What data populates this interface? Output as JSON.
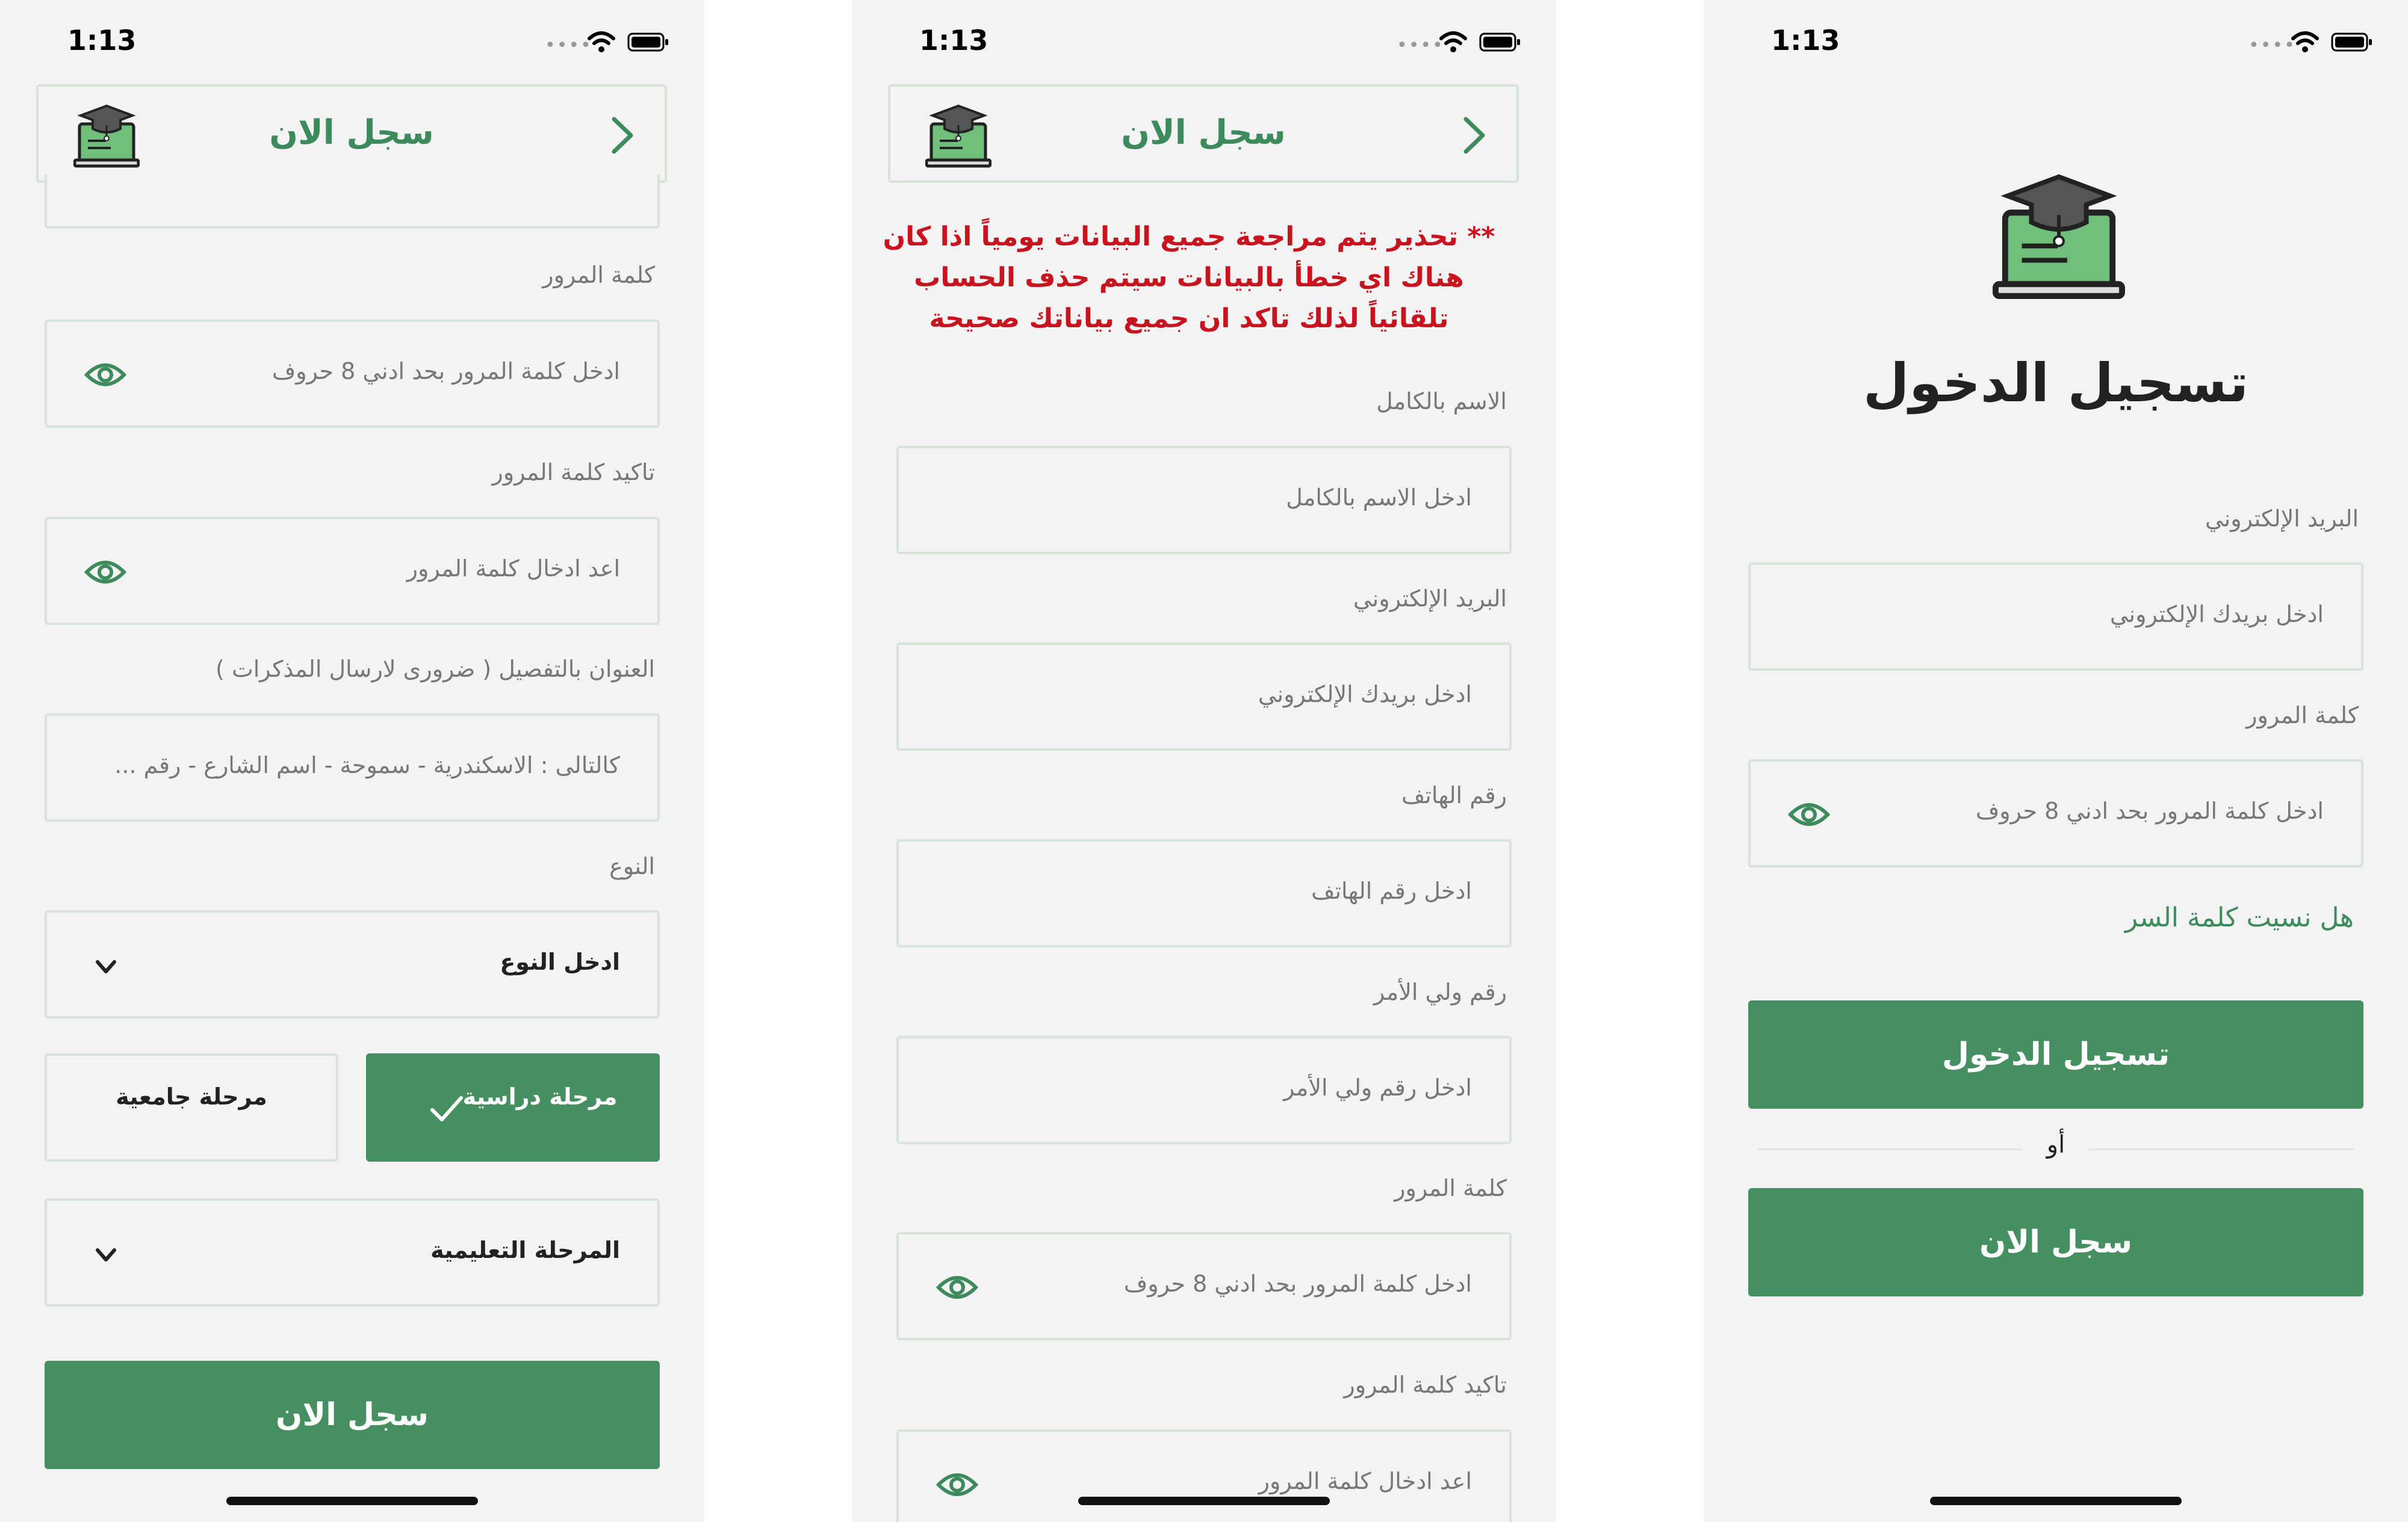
{
  "status_bar": {
    "time": "1:13"
  },
  "brand_color": "#468f60",
  "warning_color": "#c8141e",
  "screen1": {
    "header_title": "سجل الان",
    "password_label": "كلمة المرور",
    "password_placeholder": "ادخل كلمة المرور بحد ادني 8 حروف",
    "confirm_password_label": "تاكيد كلمة المرور",
    "confirm_password_placeholder": "اعد ادخال كلمة المرور",
    "address_label": "العنوان بالتفصيل ( ضرورى لارسال المذكرات )",
    "address_placeholder": "كالتالى : الاسكندرية - سموحة - اسم الشارع - رقم ...",
    "gender_label": "النوع",
    "gender_select": "ادخل النوع",
    "stage_selected": "مرحلة دراسية",
    "stage_other": "مرحلة جامعية",
    "education_select": "المرحلة التعليمية",
    "register_button": "سجل الان"
  },
  "screen2": {
    "header_title": "سجل الان",
    "warning": "** تحذير يتم مراجعة جميع البيانات يومياً اذا كان هناك اي خطأ بالبيانات سيتم حذف الحساب تلقائياً لذلك تاكد ان جميع بياناتك صحيحة",
    "fullname_label": "الاسم بالكامل",
    "fullname_placeholder": "ادخل الاسم بالكامل",
    "email_label": "البريد الإلكتروني",
    "email_placeholder": "ادخل بريدك الإلكتروني",
    "phone_label": "رقم الهاتف",
    "phone_placeholder": "ادخل رقم الهاتف",
    "guardian_label": "رقم ولي الأمر",
    "guardian_placeholder": "ادخل رقم ولي الأمر",
    "password_label": "كلمة المرور",
    "password_placeholder": "ادخل كلمة المرور بحد ادني 8 حروف",
    "confirm_password_label": "تاكيد كلمة المرور",
    "confirm_password_placeholder": "اعد ادخال كلمة المرور"
  },
  "screen3": {
    "title": "تسجيل الدخول",
    "email_label": "البريد الإلكتروني",
    "email_placeholder": "ادخل بريدك الإلكتروني",
    "password_label": "كلمة المرور",
    "password_placeholder": "ادخل كلمة المرور بحد ادني 8 حروف",
    "forgot_password": "هل نسيت كلمة السر",
    "login_button": "تسجيل الدخول",
    "or_text": "أو",
    "register_button": "سجل الان"
  }
}
